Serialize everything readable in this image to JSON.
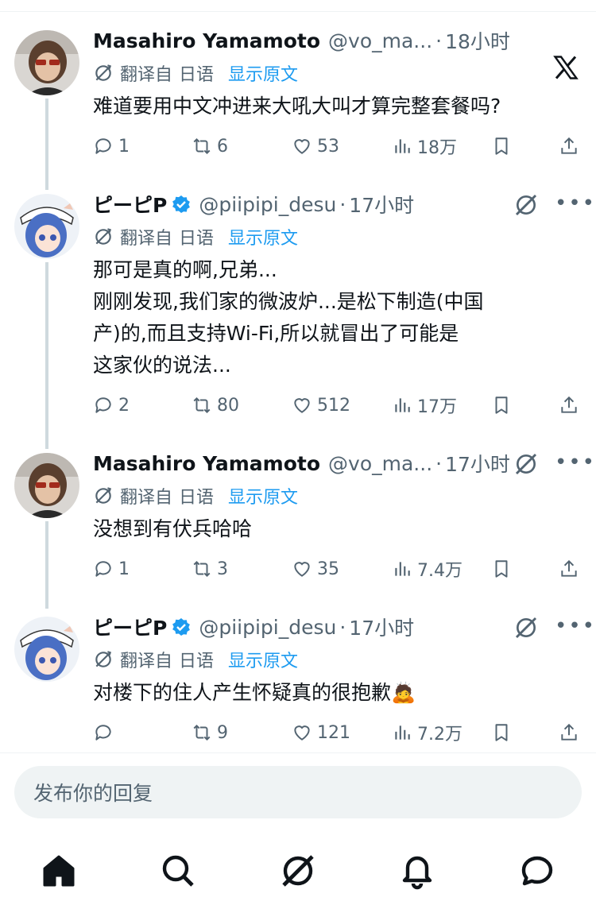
{
  "tweets": [
    {
      "name": "Masahiro Yamamoto",
      "handle": "@vo_ma...",
      "dot": "·",
      "time": "18小时",
      "verified": false,
      "translate": {
        "prefix": "翻译自",
        "lang": "日语",
        "show": "显示原文"
      },
      "text": "难道要用中文冲进来大吼大叫才算完整套餐吗?",
      "stats": {
        "replies": "1",
        "reposts": "6",
        "likes": "53",
        "views": "18万"
      }
    },
    {
      "name": "ピーピP",
      "handle": "@piipipi_desu",
      "dot": "·",
      "time": "17小时",
      "verified": true,
      "translate": {
        "prefix": "翻译自",
        "lang": "日语",
        "show": "显示原文"
      },
      "text": "那可是真的啊,兄弟...\n刚刚发现,我们家的微波炉...是松下制造(中国\n产)的,而且支持Wi-Fi,所以就冒出了可能是\n这家伙的说法...",
      "stats": {
        "replies": "2",
        "reposts": "80",
        "likes": "512",
        "views": "17万"
      }
    },
    {
      "name": "Masahiro Yamamoto",
      "handle": "@vo_ma...",
      "dot": "·",
      "time": "17小时",
      "verified": false,
      "translate": {
        "prefix": "翻译自",
        "lang": "日语",
        "show": "显示原文"
      },
      "text": "没想到有伏兵哈哈",
      "stats": {
        "replies": "1",
        "reposts": "3",
        "likes": "35",
        "views": "7.4万"
      }
    },
    {
      "name": "ピーピP",
      "handle": "@piipipi_desu",
      "dot": "·",
      "time": "17小时",
      "verified": true,
      "translate": {
        "prefix": "翻译自",
        "lang": "日语",
        "show": "显示原文"
      },
      "text": "对楼下的住人产生怀疑真的很抱歉🙇",
      "stats": {
        "replies": "",
        "reposts": "9",
        "likes": "121",
        "views": "7.2万"
      }
    }
  ],
  "reply": {
    "placeholder": "发布你的回复"
  },
  "nav": [
    "home-icon",
    "search-icon",
    "grok-icon",
    "notifications-icon",
    "messages-icon"
  ],
  "colors": {
    "accent": "#1d9bf0",
    "muted": "#536471",
    "text": "#0f1419",
    "line": "#cfd9de"
  }
}
